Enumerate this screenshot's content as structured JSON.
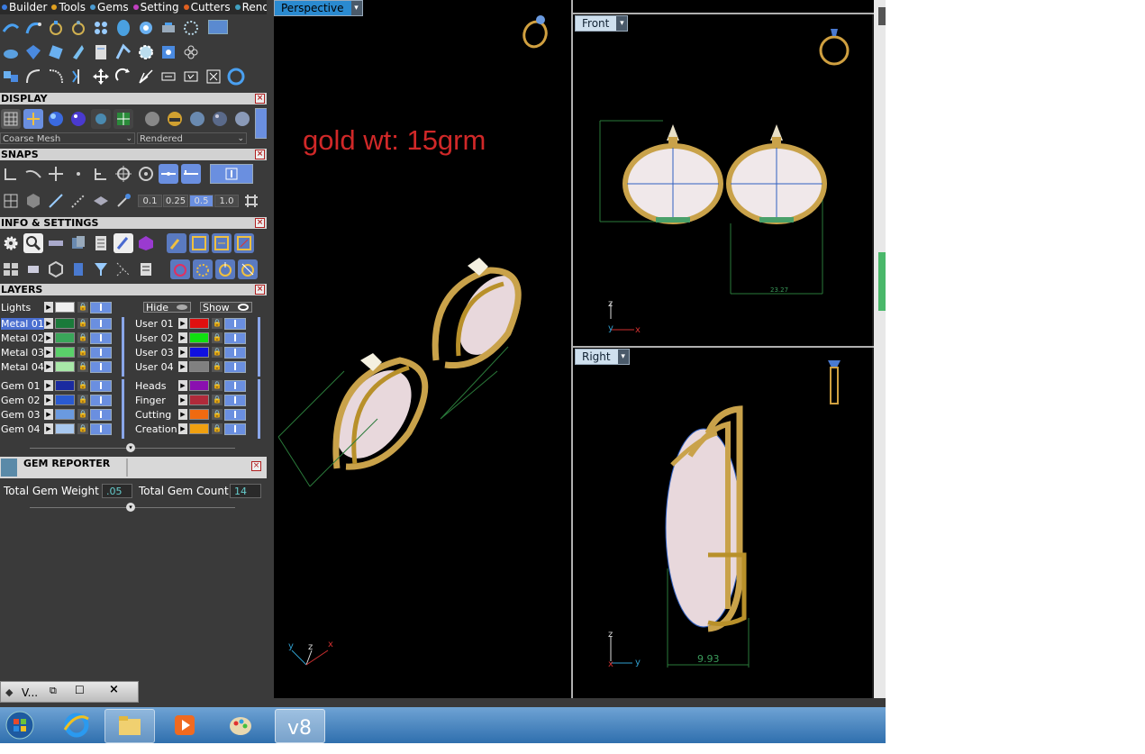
{
  "menu": [
    {
      "label": "Builder",
      "color": "#3a7be0"
    },
    {
      "label": "Tools",
      "color": "#e0a020"
    },
    {
      "label": "Gems",
      "color": "#4a9ad0"
    },
    {
      "label": "Setting",
      "color": "#c040c0"
    },
    {
      "label": "Cutters",
      "color": "#e06020"
    },
    {
      "label": "Render",
      "color": "#40a0c0"
    }
  ],
  "panels": {
    "display": "DISPLAY",
    "snaps": "SNAPS",
    "info": "INFO & SETTINGS",
    "layers": "LAYERS",
    "gem_reporter": "GEM REPORTER"
  },
  "display": {
    "mesh": "Coarse Mesh",
    "render": "Rendered"
  },
  "snaps": {
    "values": [
      "0.1",
      "0.25",
      "0.5",
      "1.0"
    ],
    "selected": "0.5"
  },
  "layers": {
    "lights": "Lights",
    "hide": "Hide",
    "show": "Show",
    "left": [
      {
        "name": "Metal 01",
        "color": "#1a7a3a",
        "selected": true
      },
      {
        "name": "Metal 02",
        "color": "#3aa65a"
      },
      {
        "name": "Metal 03",
        "color": "#5ad06a"
      },
      {
        "name": "Metal 04",
        "color": "#a8e8a8"
      },
      {
        "name": "Gem 01",
        "color": "#1a2aa0"
      },
      {
        "name": "Gem 02",
        "color": "#2a5ad0"
      },
      {
        "name": "Gem 03",
        "color": "#6a9ae0"
      },
      {
        "name": "Gem 04",
        "color": "#a8c8f0"
      }
    ],
    "right": [
      {
        "name": "User 01",
        "color": "#e01010"
      },
      {
        "name": "User 02",
        "color": "#10e010"
      },
      {
        "name": "User 03",
        "color": "#1010e0"
      },
      {
        "name": "User 04",
        "color": "#808080"
      },
      {
        "name": "Heads",
        "color": "#8a10b0"
      },
      {
        "name": "Finger",
        "color": "#b02a3a"
      },
      {
        "name": "Cutting",
        "color": "#f06a10"
      },
      {
        "name": "Creation",
        "color": "#f0a010"
      }
    ]
  },
  "gem_reporter": {
    "weight_label": "Total Gem Weight",
    "weight_value": ".05",
    "count_label": "Total Gem Count",
    "count_value": "14"
  },
  "viewports": {
    "perspective": {
      "label": "Perspective",
      "annotation": "gold wt: 15grm"
    },
    "front": {
      "label": "Front",
      "dimension": "23.27"
    },
    "right": {
      "label": "Right",
      "dimension": "9.93"
    }
  },
  "minimized_window": {
    "label": "V..."
  },
  "accent_colors": {
    "annotation": "#d02828",
    "gold": "#c9a24a",
    "dimension": "#3a9a5a",
    "axis_x": "#d03030",
    "axis_y": "#30a0d0"
  }
}
